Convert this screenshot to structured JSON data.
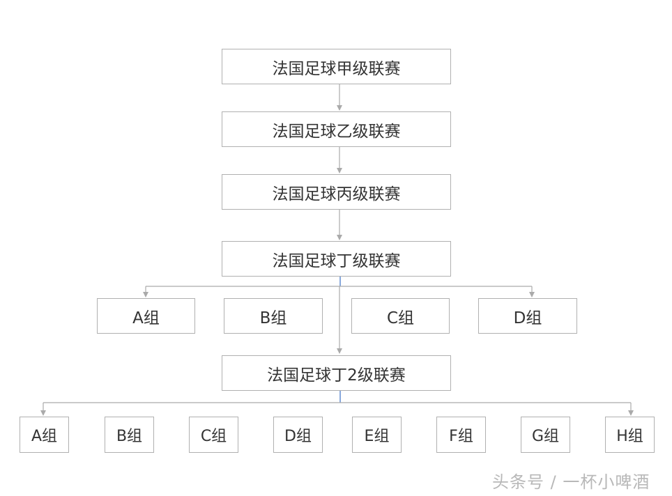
{
  "levels": [
    "法国足球甲级联赛",
    "法国足球乙级联赛",
    "法国足球丙级联赛",
    "法国足球丁级联赛",
    "法国足球丁2级联赛"
  ],
  "level4_groups": [
    "A组",
    "B组",
    "C组",
    "D组"
  ],
  "level5_groups": [
    "A组",
    "B组",
    "C组",
    "D组",
    "E组",
    "F组",
    "G组",
    "H组"
  ],
  "watermark": "头条号 / 一杯小啤酒",
  "colors": {
    "border": "#b0b0b0",
    "connector": "#aaaaaa",
    "stem": "#3a6fc4"
  }
}
